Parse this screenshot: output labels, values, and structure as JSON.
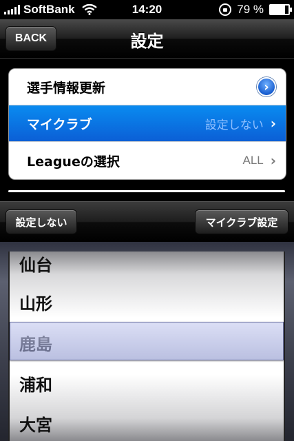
{
  "status": {
    "carrier": "SoftBank",
    "time": "14:20",
    "battery": "79 %",
    "battery_fraction": 0.79
  },
  "nav": {
    "back_label": "BACK",
    "title": "設定"
  },
  "settings": {
    "rows": [
      {
        "label": "選手情報更新",
        "value": "",
        "accessory": "detail-disclosure-icon"
      },
      {
        "label": "マイクラブ",
        "value": "設定しない",
        "accessory": "chevron-right-icon",
        "selected": true
      },
      {
        "label": "Leagueの選択",
        "value": "ALL",
        "accessory": "chevron-right-icon"
      }
    ]
  },
  "toolbar": {
    "left_label": "設定しない",
    "right_label": "マイクラブ設定"
  },
  "picker": {
    "items": [
      "仙台",
      "山形",
      "鹿島",
      "浦和",
      "大宮"
    ],
    "selected_index": 2
  },
  "colors": {
    "selected_row": "#0b6fe0",
    "disclosure": "#1a5fd0"
  }
}
